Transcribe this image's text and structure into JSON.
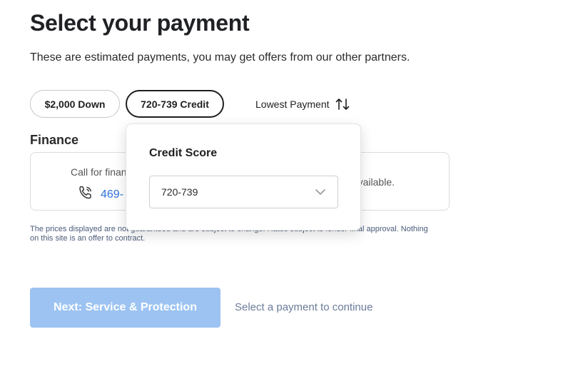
{
  "header": {
    "title": "Select your payment",
    "subtitle": "These are estimated payments, you may get offers from our other partners."
  },
  "filters": {
    "down_payment_label": "$2,000 Down",
    "credit_label": "720-739 Credit",
    "sort_label": "Lowest Payment"
  },
  "finance": {
    "section_label": "Finance",
    "call_text": "Call for finan",
    "phone_number": "469-",
    "available_text": "vailable."
  },
  "disclaimer": "The prices displayed are not guaranteed and are subject to change. Rates subject to lender final approval. Nothing on this site is an offer to contract.",
  "credit_popover": {
    "title": "Credit Score",
    "selected_value": "720-739"
  },
  "footer": {
    "next_button_label": "Next: Service & Protection",
    "hint": "Select a payment to continue"
  },
  "colors": {
    "link": "#2f6fdc",
    "button_disabled_bg": "#9cc3f2",
    "hint_text": "#6b7c99"
  }
}
